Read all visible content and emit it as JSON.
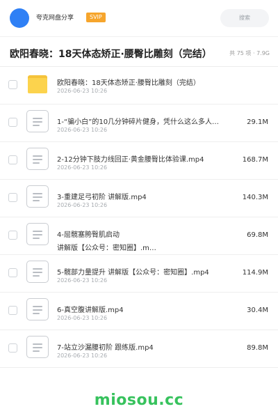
{
  "header": {
    "brand": "夸克网盘分享",
    "badge": "SVIP",
    "search_placeholder": "搜索",
    "accent_color": "#2f80f5",
    "badge_color": "#f6a52c"
  },
  "share": {
    "title": "欧阳春晓：18天体态矫正·腰臀比雕刻（完结）",
    "meta": "共 75 项 · 7.9G"
  },
  "files": [
    {
      "type": "folder",
      "name": "欧阳春晓：18天体态矫正·腰臀比雕刻（完结）",
      "date": "2026-06-23 10:26",
      "size": ""
    },
    {
      "type": "file",
      "name": "1-“骗小白”的10几分钟碎片健身，凭什么这么多人…",
      "date": "2026-06-23 10:26",
      "size": "29.1M"
    },
    {
      "type": "file",
      "name": "2-12分钟下肢力线回正·黄金腰臀比体验课.mp4",
      "date": "2026-06-23 10:26",
      "size": "168.7M"
    },
    {
      "type": "file",
      "name": "3-重建足弓初阶 讲解版.mp4",
      "date": "2026-06-23 10:26",
      "size": "140.3M"
    },
    {
      "type": "file",
      "name": "4-屈髋塞胯臀肌启动",
      "name2": "讲解版【公众号：密知圈】.m…",
      "date": "",
      "size": "69.8M"
    },
    {
      "type": "file",
      "name": "5-髋部力量提升 讲解版【公众号：密知圈】.mp4",
      "date": "2026-06-23 10:26",
      "size": "114.9M"
    },
    {
      "type": "file",
      "name": "6-真空腹讲解版.mp4",
      "date": "2026-06-23 10:26",
      "size": "30.4M"
    },
    {
      "type": "file",
      "name": "7-站立沙漏腰初阶 跟练版.mp4",
      "date": "2026-06-23 10:26",
      "size": "89.8M"
    }
  ],
  "watermark": "miosou.cc",
  "watermark_color": "#37c25d"
}
